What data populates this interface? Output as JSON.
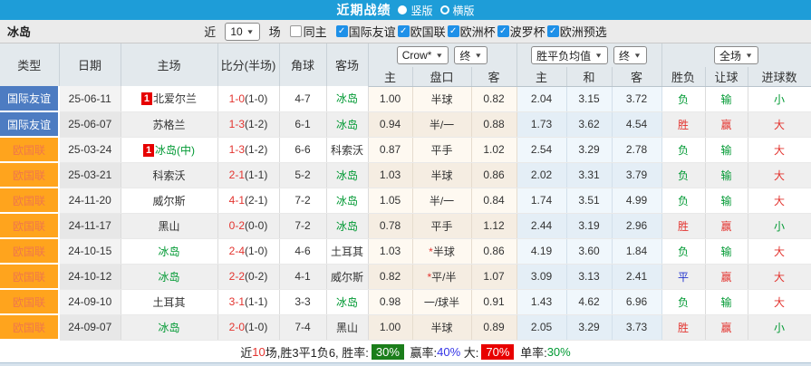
{
  "title_bar": {
    "title": "近期战绩",
    "layout_options": [
      {
        "label": "竖版",
        "selected": true
      },
      {
        "label": "横版",
        "selected": false
      }
    ]
  },
  "filter_bar": {
    "team_name": "冰岛",
    "recent_label": "近",
    "match_count": "10",
    "matches_label": "场",
    "same_home_label": "同主",
    "league_filters": [
      {
        "label": "国际友谊",
        "checked": true
      },
      {
        "label": "欧国联",
        "checked": true
      },
      {
        "label": "欧洲杯",
        "checked": true
      },
      {
        "label": "波罗杯",
        "checked": true
      },
      {
        "label": "欧洲预选",
        "checked": true
      }
    ]
  },
  "table": {
    "main_headers": [
      "类型",
      "日期",
      "主场",
      "比分(半场)",
      "角球",
      "客场"
    ],
    "sub_headers": [
      "主",
      "盘口",
      "客",
      "主",
      "和",
      "客",
      "胜负",
      "让球",
      "进球数"
    ],
    "dropdowns": {
      "odds_company": "Crow*",
      "odds_stage": "终",
      "avg_type": "胜平负均值",
      "avg_stage": "终",
      "scope": "全场"
    },
    "rows": [
      {
        "league": "国际友谊",
        "league_type": "friendly",
        "date": "25-06-11",
        "home": {
          "badge": "1",
          "name": "北爱尔兰",
          "highlight": false
        },
        "score_full": "1-0",
        "score_half": "(1-0)",
        "corner": "4-7",
        "away": {
          "name": "冰岛",
          "highlight": true
        },
        "crow_home": "1.00",
        "handicap": "半球",
        "handicap_star": false,
        "crow_away": "0.82",
        "avg_home": "2.04",
        "avg_draw": "3.15",
        "avg_away": "3.72",
        "result_wdl": "负",
        "result_handicap": "输",
        "result_goals": "小"
      },
      {
        "league": "国际友谊",
        "league_type": "friendly",
        "date": "25-06-07",
        "home": {
          "badge": "",
          "name": "苏格兰",
          "highlight": false
        },
        "score_full": "1-3",
        "score_half": "(1-2)",
        "corner": "6-1",
        "away": {
          "name": "冰岛",
          "highlight": true
        },
        "crow_home": "0.94",
        "handicap": "半/一",
        "handicap_star": false,
        "crow_away": "0.88",
        "avg_home": "1.73",
        "avg_draw": "3.62",
        "avg_away": "4.54",
        "result_wdl": "胜",
        "result_handicap": "赢",
        "result_goals": "大"
      },
      {
        "league": "欧国联",
        "league_type": "nations",
        "date": "25-03-24",
        "home": {
          "badge": "1",
          "name": "冰岛(中)",
          "highlight": true
        },
        "score_full": "1-3",
        "score_half": "(1-2)",
        "corner": "6-6",
        "away": {
          "name": "科索沃",
          "highlight": false
        },
        "crow_home": "0.87",
        "handicap": "平手",
        "handicap_star": false,
        "crow_away": "1.02",
        "avg_home": "2.54",
        "avg_draw": "3.29",
        "avg_away": "2.78",
        "result_wdl": "负",
        "result_handicap": "输",
        "result_goals": "大"
      },
      {
        "league": "欧国联",
        "league_type": "nations",
        "date": "25-03-21",
        "home": {
          "badge": "",
          "name": "科索沃",
          "highlight": false
        },
        "score_full": "2-1",
        "score_half": "(1-1)",
        "corner": "5-2",
        "away": {
          "name": "冰岛",
          "highlight": true
        },
        "crow_home": "1.03",
        "handicap": "半球",
        "handicap_star": false,
        "crow_away": "0.86",
        "avg_home": "2.02",
        "avg_draw": "3.31",
        "avg_away": "3.79",
        "result_wdl": "负",
        "result_handicap": "输",
        "result_goals": "大"
      },
      {
        "league": "欧国联",
        "league_type": "nations",
        "date": "24-11-20",
        "home": {
          "badge": "",
          "name": "威尔斯",
          "highlight": false
        },
        "score_full": "4-1",
        "score_half": "(2-1)",
        "corner": "7-2",
        "away": {
          "name": "冰岛",
          "highlight": true
        },
        "crow_home": "1.05",
        "handicap": "半/一",
        "handicap_star": false,
        "crow_away": "0.84",
        "avg_home": "1.74",
        "avg_draw": "3.51",
        "avg_away": "4.99",
        "result_wdl": "负",
        "result_handicap": "输",
        "result_goals": "大"
      },
      {
        "league": "欧国联",
        "league_type": "nations",
        "date": "24-11-17",
        "home": {
          "badge": "",
          "name": "黑山",
          "highlight": false
        },
        "score_full": "0-2",
        "score_half": "(0-0)",
        "corner": "7-2",
        "away": {
          "name": "冰岛",
          "highlight": true
        },
        "crow_home": "0.78",
        "handicap": "平手",
        "handicap_star": false,
        "crow_away": "1.12",
        "avg_home": "2.44",
        "avg_draw": "3.19",
        "avg_away": "2.96",
        "result_wdl": "胜",
        "result_handicap": "赢",
        "result_goals": "小"
      },
      {
        "league": "欧国联",
        "league_type": "nations",
        "date": "24-10-15",
        "home": {
          "badge": "",
          "name": "冰岛",
          "highlight": true
        },
        "score_full": "2-4",
        "score_half": "(1-0)",
        "corner": "4-6",
        "away": {
          "name": "土耳其",
          "highlight": false
        },
        "crow_home": "1.03",
        "handicap": "半球",
        "handicap_star": true,
        "crow_away": "0.86",
        "avg_home": "4.19",
        "avg_draw": "3.60",
        "avg_away": "1.84",
        "result_wdl": "负",
        "result_handicap": "输",
        "result_goals": "大"
      },
      {
        "league": "欧国联",
        "league_type": "nations",
        "date": "24-10-12",
        "home": {
          "badge": "",
          "name": "冰岛",
          "highlight": true
        },
        "score_full": "2-2",
        "score_half": "(0-2)",
        "corner": "4-1",
        "away": {
          "name": "威尔斯",
          "highlight": false
        },
        "crow_home": "0.82",
        "handicap": "平/半",
        "handicap_star": true,
        "crow_away": "1.07",
        "avg_home": "3.09",
        "avg_draw": "3.13",
        "avg_away": "2.41",
        "result_wdl": "平",
        "result_handicap": "赢",
        "result_goals": "大"
      },
      {
        "league": "欧国联",
        "league_type": "nations",
        "date": "24-09-10",
        "home": {
          "badge": "",
          "name": "土耳其",
          "highlight": false
        },
        "score_full": "3-1",
        "score_half": "(1-1)",
        "corner": "3-3",
        "away": {
          "name": "冰岛",
          "highlight": true
        },
        "crow_home": "0.98",
        "handicap": "一/球半",
        "handicap_star": false,
        "crow_away": "0.91",
        "avg_home": "1.43",
        "avg_draw": "4.62",
        "avg_away": "6.96",
        "result_wdl": "负",
        "result_handicap": "输",
        "result_goals": "大"
      },
      {
        "league": "欧国联",
        "league_type": "nations",
        "date": "24-09-07",
        "home": {
          "badge": "",
          "name": "冰岛",
          "highlight": true
        },
        "score_full": "2-0",
        "score_half": "(1-0)",
        "corner": "7-4",
        "away": {
          "name": "黑山",
          "highlight": false
        },
        "crow_home": "1.00",
        "handicap": "半球",
        "handicap_star": false,
        "crow_away": "0.89",
        "avg_home": "2.05",
        "avg_draw": "3.29",
        "avg_away": "3.73",
        "result_wdl": "胜",
        "result_handicap": "赢",
        "result_goals": "小"
      }
    ]
  },
  "summary": {
    "segments": [
      {
        "text": "近",
        "style": "plain"
      },
      {
        "text": "10",
        "style": "red"
      },
      {
        "text": "场,胜3平1负6, 胜率:",
        "style": "plain"
      },
      {
        "text": "30%",
        "style": "badge-green"
      },
      {
        "text": " 赢率:",
        "style": "plain"
      },
      {
        "text": "40%",
        "style": "blue"
      },
      {
        "text": " 大:",
        "style": "plain"
      },
      {
        "text": "70%",
        "style": "badge-red"
      },
      {
        "text": " 单率:",
        "style": "plain"
      },
      {
        "text": "30%",
        "style": "green"
      }
    ]
  },
  "colors": {
    "title_bar_blue": "#1E9DD8",
    "friendly_league_bg": "#4D7CC2",
    "nations_league_bg": "#FFA41D",
    "win_red": "#E3342F",
    "draw_blue": "#2233CC",
    "lose_green": "#009933",
    "iceland_team_green": "#009933",
    "checkbox_blue": "#1E90E8"
  }
}
